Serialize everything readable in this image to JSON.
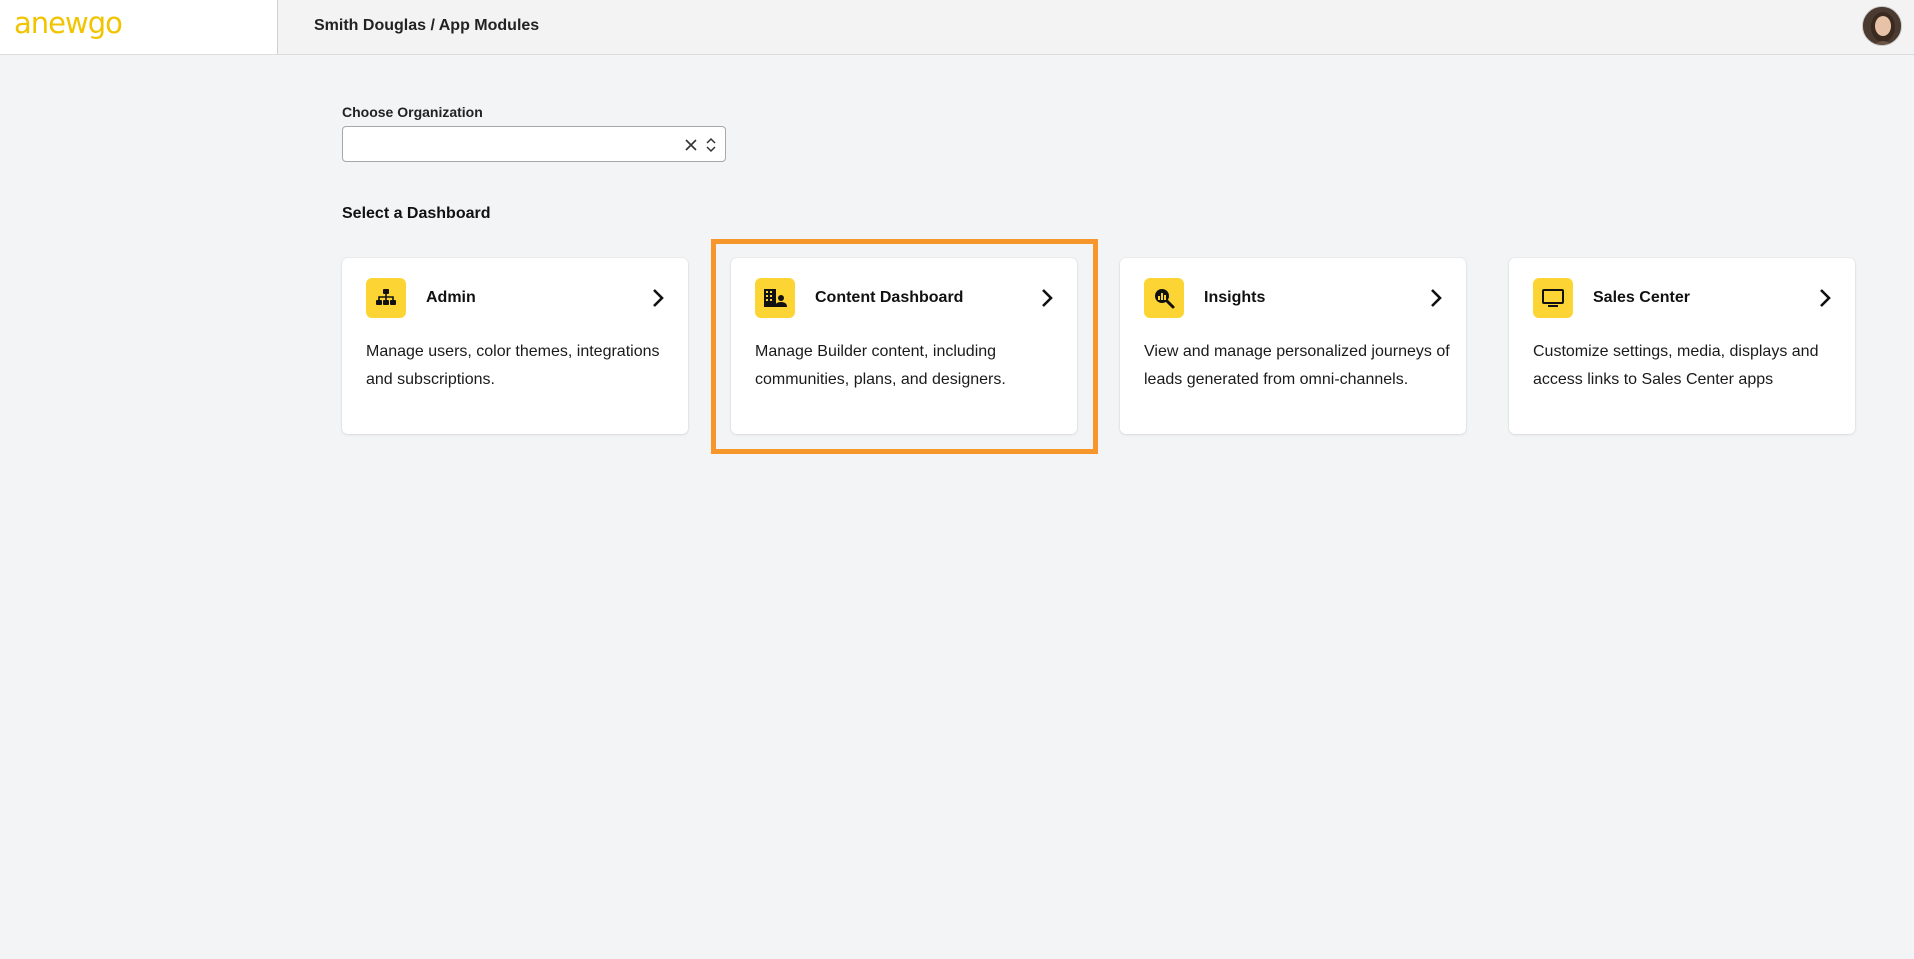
{
  "header": {
    "logo_text": "anewgo",
    "breadcrumb": "Smith Douglas / App Modules"
  },
  "organization": {
    "label": "Choose Organization",
    "value": ""
  },
  "dashboards": {
    "section_title": "Select a Dashboard",
    "cards": [
      {
        "title": "Admin",
        "description": "Manage users, color themes, integrations and subscriptions.",
        "icon": "sitemap-icon"
      },
      {
        "title": "Content Dashboard",
        "description": "Manage Builder content, including communities, plans, and designers.",
        "icon": "building-user-icon"
      },
      {
        "title": "Insights",
        "description": "View and manage personalized journeys of leads generated from omni-channels.",
        "icon": "analytics-search-icon"
      },
      {
        "title": "Sales Center",
        "description": "Customize settings, media, displays and access links to Sales Center apps",
        "icon": "monitor-icon"
      }
    ]
  },
  "colors": {
    "accent": "#fcd535",
    "logo": "#f2c400",
    "highlight": "#f7962b",
    "background": "#f3f4f6"
  }
}
